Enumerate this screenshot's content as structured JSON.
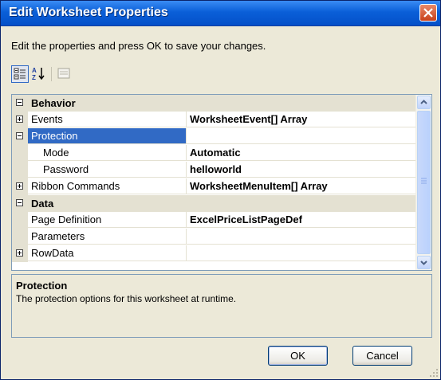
{
  "window": {
    "title": "Edit Worksheet Properties",
    "instructions": "Edit the properties and press OK to save your changes."
  },
  "toolbar": {
    "buttons": [
      "categorized-icon",
      "alphabetical-icon",
      "property-pages-icon"
    ]
  },
  "grid": {
    "rows": [
      {
        "type": "category",
        "label": "Behavior",
        "expanded": true
      },
      {
        "type": "property",
        "name": "Events",
        "value": "WorksheetEvent[] Array",
        "expander": "plus"
      },
      {
        "type": "property",
        "name": "Protection",
        "value": "",
        "expander": "minus",
        "selected": true
      },
      {
        "type": "property",
        "name": "Mode",
        "value": "Automatic",
        "indent": true
      },
      {
        "type": "property",
        "name": "Password",
        "value": "helloworld",
        "indent": true
      },
      {
        "type": "property",
        "name": "Ribbon Commands",
        "value": "WorksheetMenuItem[] Array",
        "expander": "plus"
      },
      {
        "type": "category",
        "label": "Data",
        "expanded": true
      },
      {
        "type": "property",
        "name": "Page Definition",
        "value": "ExcelPriceListPageDef"
      },
      {
        "type": "property",
        "name": "Parameters",
        "value": ""
      },
      {
        "type": "property",
        "name": "RowData",
        "value": "",
        "expander": "plus"
      }
    ]
  },
  "description": {
    "title": "Protection",
    "text": "The protection options for this worksheet at runtime."
  },
  "buttons": {
    "ok": "OK",
    "cancel": "Cancel"
  },
  "colors": {
    "titlebar": "#0A5FD8",
    "selection": "#316AC5",
    "category": "#E4E1D2",
    "dialog": "#ECE9D8"
  }
}
